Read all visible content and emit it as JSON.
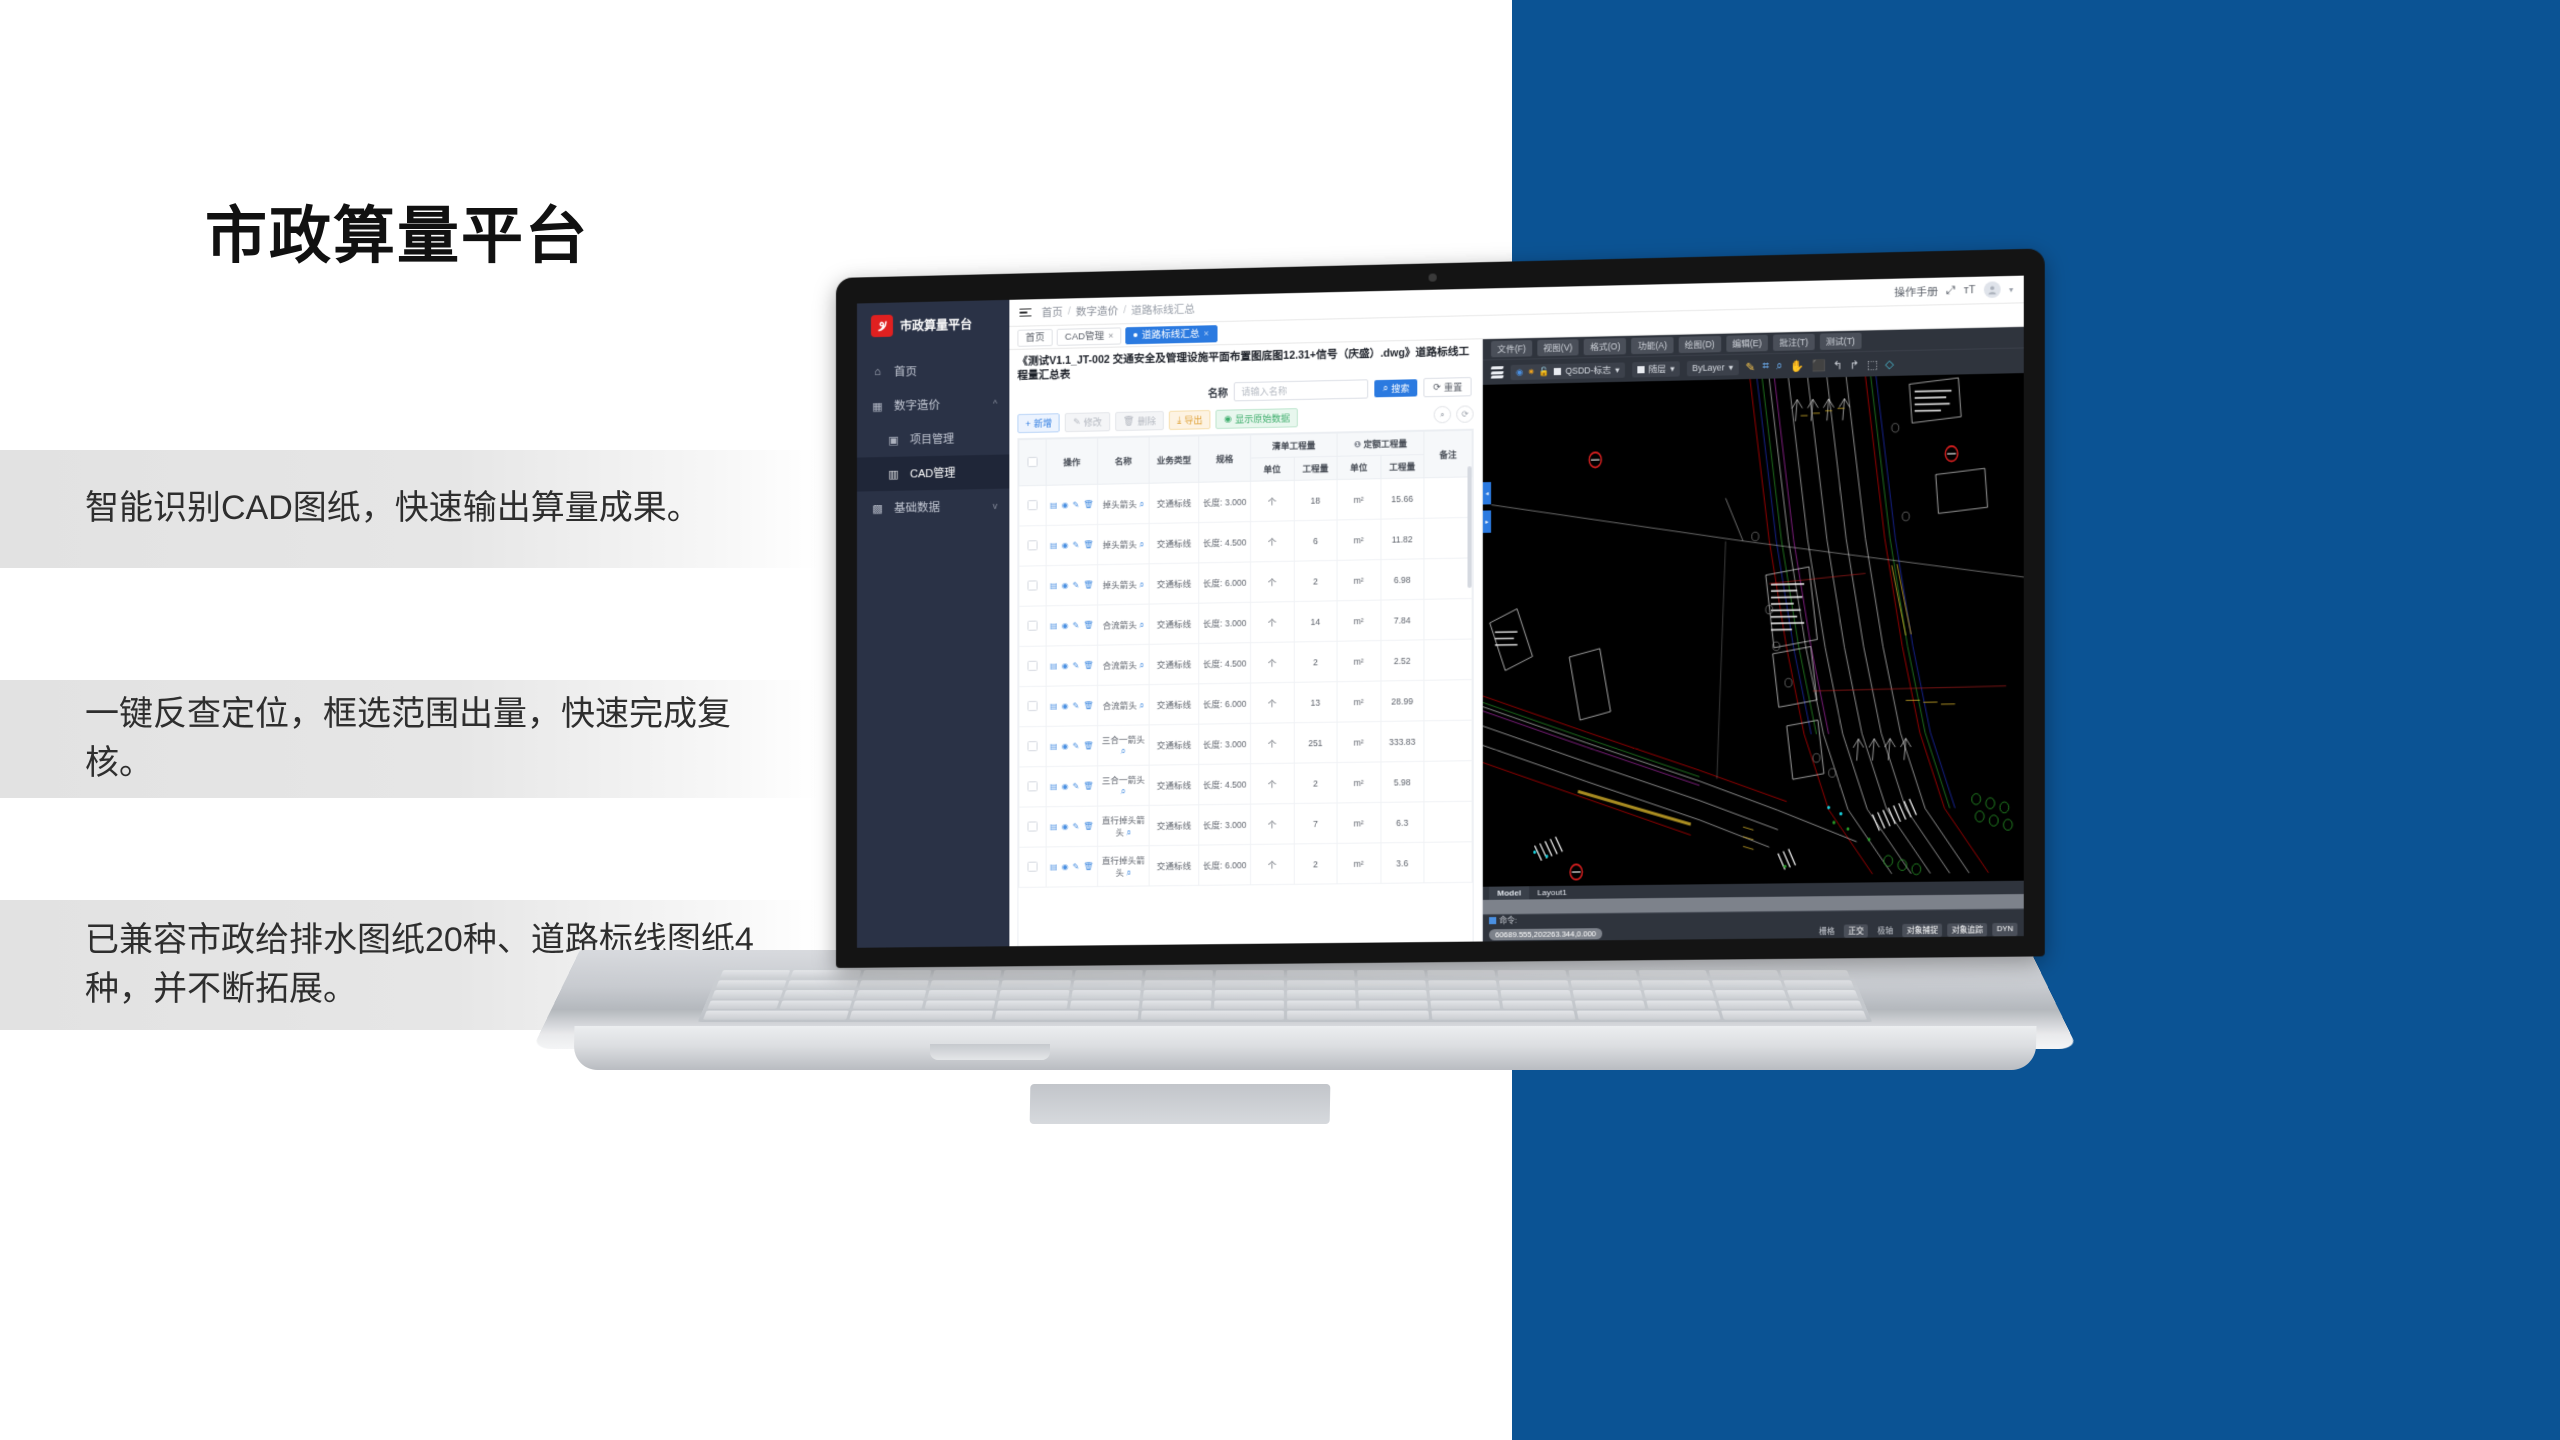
{
  "slide": {
    "headline": "市政算量平台",
    "features": [
      "智能识别CAD图纸，快速输出算量成果。",
      "一键反查定位，框选范围出量，快速完成复核。",
      "已兼容市政给排水图纸20种、道路标线图纸4种，并不断拓展。"
    ],
    "accent_blue": "#0b5394"
  },
  "app": {
    "brand": {
      "name": "市政算量平台",
      "logo_icon": "spiral-logo-icon",
      "logo_color": "#e02020"
    },
    "sidebar": {
      "items": [
        {
          "label": "首页",
          "icon": "home-icon",
          "active": false,
          "sub": false,
          "caret": ""
        },
        {
          "label": "数字造价",
          "icon": "grid-icon",
          "active": false,
          "sub": false,
          "caret": "^"
        },
        {
          "label": "项目管理",
          "icon": "project-icon",
          "active": false,
          "sub": true,
          "caret": ""
        },
        {
          "label": "CAD管理",
          "icon": "chart-icon",
          "active": true,
          "sub": true,
          "caret": ""
        },
        {
          "label": "基础数据",
          "icon": "database-icon",
          "active": false,
          "sub": false,
          "caret": "v"
        }
      ]
    },
    "topbar": {
      "menu_icon": "hamburger-icon",
      "breadcrumb": [
        "首页",
        "数字造价",
        "道路标线汇总"
      ],
      "separator": "/",
      "manual_label": "操作手册",
      "fullscreen_icon": "fullscreen-icon",
      "textsize_icon": "text-size-icon",
      "avatar_icon": "user-avatar-icon",
      "caret_icon": "chevron-down-icon"
    },
    "tabs": [
      {
        "label": "首页",
        "closable": false,
        "active": false
      },
      {
        "label": "CAD管理",
        "closable": true,
        "active": false
      },
      {
        "label": "道路标线汇总",
        "closable": true,
        "active": true
      }
    ],
    "document_title": "《测试V1.1_JT-002 交通安全及管理设施平面布置图底图12.31+信号（庆盛）.dwg》道路标线工程量汇总表",
    "search": {
      "label": "名称",
      "placeholder": "请输入名称",
      "value": "",
      "search_button": "搜索",
      "search_icon": "search-icon",
      "reset_button": "重置",
      "reset_icon": "refresh-icon"
    },
    "toolbar": {
      "buttons": [
        {
          "label": "新增",
          "icon": "plus-icon",
          "style": "primary"
        },
        {
          "label": "修改",
          "icon": "edit-icon",
          "style": "disabled"
        },
        {
          "label": "删除",
          "icon": "trash-icon",
          "style": "disabled"
        },
        {
          "label": "导出",
          "icon": "download-icon",
          "style": "warning"
        },
        {
          "label": "显示原始数据",
          "icon": "eye-icon",
          "style": "success"
        }
      ],
      "right_icons": [
        "search-circle-icon",
        "refresh-circle-icon"
      ]
    },
    "table": {
      "group_headers": [
        {
          "label": "清单工程量",
          "span": 2,
          "info_icon": false
        },
        {
          "label": "定额工程量",
          "span": 2,
          "info_icon": true
        }
      ],
      "columns": [
        "",
        "操作",
        "名称",
        "业务类型",
        "规格",
        "单位",
        "工程量",
        "单位",
        "工程量",
        "备注"
      ],
      "row_action_icons": [
        "detail-icon",
        "locate-icon",
        "edit-icon",
        "delete-icon"
      ],
      "name_search_icon": "magnifier-icon",
      "rows": [
        {
          "name": "掉头箭头",
          "type": "交通标线",
          "spec": "长度: 3.000",
          "unit1": "个",
          "qty1": "18",
          "unit2": "m²",
          "qty2": "15.66",
          "remark": ""
        },
        {
          "name": "掉头箭头",
          "type": "交通标线",
          "spec": "长度: 4.500",
          "unit1": "个",
          "qty1": "6",
          "unit2": "m²",
          "qty2": "11.82",
          "remark": ""
        },
        {
          "name": "掉头箭头",
          "type": "交通标线",
          "spec": "长度: 6.000",
          "unit1": "个",
          "qty1": "2",
          "unit2": "m²",
          "qty2": "6.98",
          "remark": ""
        },
        {
          "name": "合流箭头",
          "type": "交通标线",
          "spec": "长度: 3.000",
          "unit1": "个",
          "qty1": "14",
          "unit2": "m²",
          "qty2": "7.84",
          "remark": ""
        },
        {
          "name": "合流箭头",
          "type": "交通标线",
          "spec": "长度: 4.500",
          "unit1": "个",
          "qty1": "2",
          "unit2": "m²",
          "qty2": "2.52",
          "remark": ""
        },
        {
          "name": "合流箭头",
          "type": "交通标线",
          "spec": "长度: 6.000",
          "unit1": "个",
          "qty1": "13",
          "unit2": "m²",
          "qty2": "28.99",
          "remark": ""
        },
        {
          "name": "三合一箭头",
          "type": "交通标线",
          "spec": "长度: 3.000",
          "unit1": "个",
          "qty1": "251",
          "unit2": "m²",
          "qty2": "333.83",
          "remark": ""
        },
        {
          "name": "三合一箭头",
          "type": "交通标线",
          "spec": "长度: 4.500",
          "unit1": "个",
          "qty1": "2",
          "unit2": "m²",
          "qty2": "5.98",
          "remark": ""
        },
        {
          "name": "直行掉头箭头",
          "type": "交通标线",
          "spec": "长度: 3.000",
          "unit1": "个",
          "qty1": "7",
          "unit2": "m²",
          "qty2": "6.3",
          "remark": ""
        },
        {
          "name": "直行掉头箭头",
          "type": "交通标线",
          "spec": "长度: 6.000",
          "unit1": "个",
          "qty1": "2",
          "unit2": "m²",
          "qty2": "3.6",
          "remark": ""
        }
      ]
    },
    "cad": {
      "menu_items": [
        "文件(F)",
        "视图(V)",
        "格式(O)",
        "功能(A)",
        "绘图(D)",
        "编辑(E)",
        "批注(T)",
        "测试(T)"
      ],
      "layers_icon": "layers-icon",
      "layer_select": {
        "value": "QSDD-标志",
        "eye_icon": "eye-icon",
        "sun_icon": "sun-icon",
        "lock_icon": "unlock-icon",
        "caret": "▾"
      },
      "color_select": {
        "value": "随层",
        "caret": "▾"
      },
      "linetype_select": {
        "value": "ByLayer",
        "caret": "▾"
      },
      "tool_icons": [
        "pen-icon",
        "zoom-window-icon",
        "zoom-extents-icon",
        "pan-icon",
        "zoom-3d-icon",
        "undo-icon",
        "redo-icon",
        "measure-icon",
        "eraser-icon"
      ],
      "model_tabs": [
        {
          "label": "Model",
          "active": true
        },
        {
          "label": "Layout1",
          "active": false
        }
      ],
      "command_label": "命令:",
      "coordinates": "60689.555,202263.344,0.000",
      "status_toggles": [
        {
          "label": "栅格",
          "on": false
        },
        {
          "label": "正交",
          "on": true
        },
        {
          "label": "极轴",
          "on": false
        },
        {
          "label": "对象捕捉",
          "on": true
        },
        {
          "label": "对象追踪",
          "on": true
        },
        {
          "label": "DYN",
          "on": true
        }
      ],
      "side_handles": [
        "collapse-handle-left",
        "collapse-handle-right"
      ]
    }
  }
}
